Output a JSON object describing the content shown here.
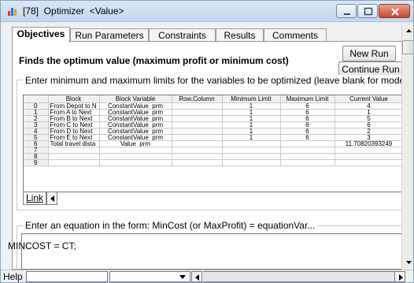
{
  "window": {
    "title": "[78]  Optimizer  <Value>"
  },
  "tabs": [
    {
      "label": "Objectives",
      "active": true
    },
    {
      "label": "Run Parameters",
      "active": false
    },
    {
      "label": "Constraints",
      "active": false
    },
    {
      "label": "Results",
      "active": false
    },
    {
      "label": "Comments",
      "active": false
    }
  ],
  "objectives": {
    "heading": "Finds the optimum value (maximum profit or minimum cost)",
    "new_run_label": "New Run",
    "continue_run_label": "Continue Run",
    "limits_group_label": "Enter minimum and maximum limits for the variables to be optimized (leave blank for model out",
    "equation_group_label": "Enter an equation in the form: MinCost (or MaxProfit) = equationVar...",
    "equation_value": "MINCOST = CT;"
  },
  "grid": {
    "columns": [
      "Block",
      "Block Variable",
      "Row,Column",
      "Minimum Limit",
      "Maximum Limit",
      "Current Value"
    ],
    "rows": [
      {
        "idx": "0",
        "block": "From Depot to N",
        "variable": "ConstantValue_prm",
        "rowcol": "",
        "min": "1",
        "max": "6",
        "current": "4"
      },
      {
        "idx": "1",
        "block": "From A to Next",
        "variable": "ConstantValue_prm",
        "rowcol": "",
        "min": "1",
        "max": "6",
        "current": "1"
      },
      {
        "idx": "2",
        "block": "From B to Next",
        "variable": "ConstantValue_prm",
        "rowcol": "",
        "min": "1",
        "max": "6",
        "current": "5"
      },
      {
        "idx": "3",
        "block": "From C to Next",
        "variable": "ConstantValue_prm",
        "rowcol": "",
        "min": "1",
        "max": "6",
        "current": "6"
      },
      {
        "idx": "4",
        "block": "From D to Next",
        "variable": "ConstantValue_prm",
        "rowcol": "",
        "min": "1",
        "max": "6",
        "current": "2"
      },
      {
        "idx": "5",
        "block": "From E to Next",
        "variable": "ConstantValue_prm",
        "rowcol": "",
        "min": "1",
        "max": "6",
        "current": "3"
      },
      {
        "idx": "6",
        "block": "Total travel dista",
        "variable": "Value_prm",
        "rowcol": "",
        "min": "",
        "max": "",
        "current": "11.70820393249"
      },
      {
        "idx": "7",
        "block": "",
        "variable": "",
        "rowcol": "",
        "min": "",
        "max": "",
        "current": ""
      },
      {
        "idx": "8",
        "block": "",
        "variable": "",
        "rowcol": "",
        "min": "",
        "max": "",
        "current": ""
      },
      {
        "idx": "9",
        "block": "",
        "variable": "",
        "rowcol": "",
        "min": "",
        "max": "",
        "current": ""
      }
    ],
    "sheet_tab_label": "Link"
  },
  "statusbar": {
    "help_label": "Help"
  }
}
